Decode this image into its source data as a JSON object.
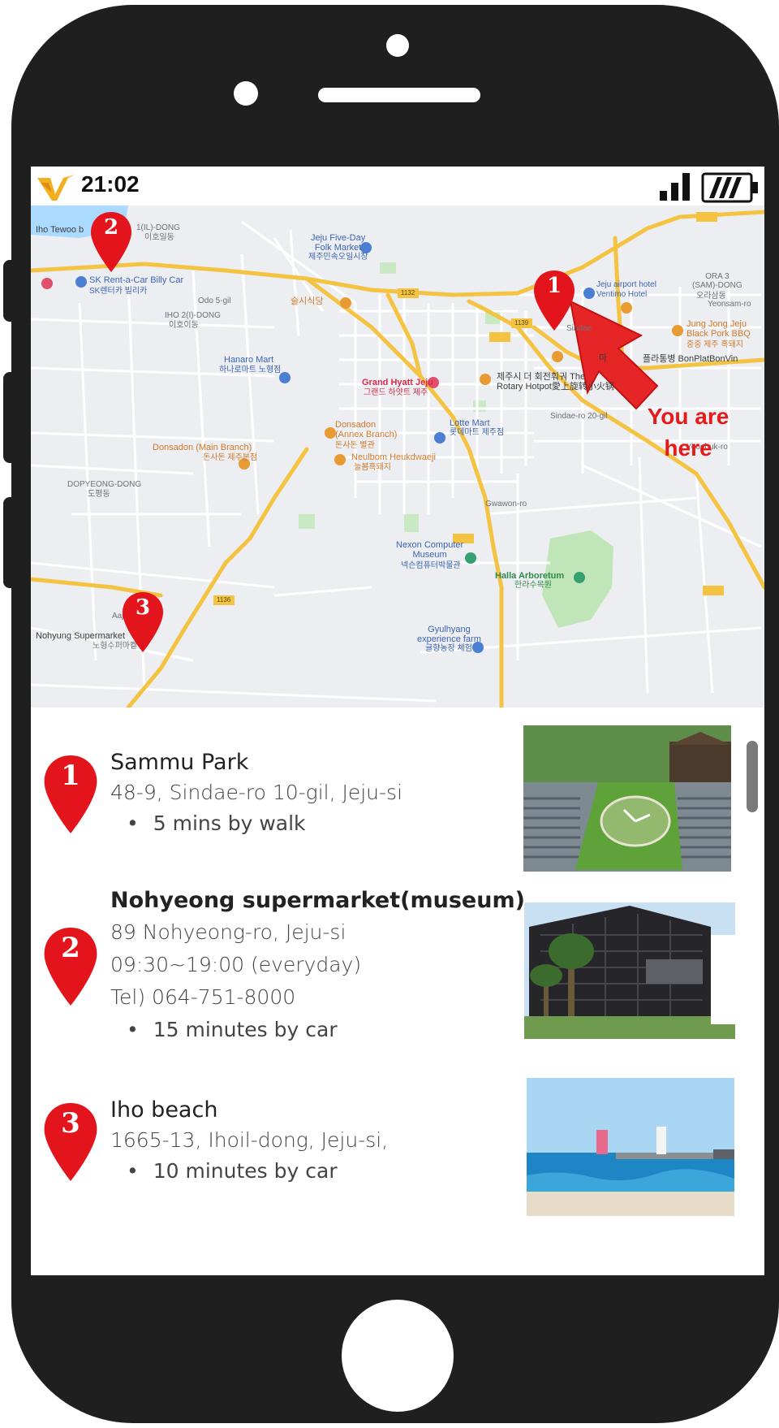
{
  "status_bar": {
    "time": "21:02",
    "logo": "brand-v-logo",
    "signal": "signal-bars-icon",
    "battery": "battery-icon"
  },
  "map": {
    "callout": {
      "line1": "You are",
      "line2": "here"
    },
    "pins": [
      {
        "number": "1"
      },
      {
        "number": "2"
      },
      {
        "number": "3"
      }
    ],
    "labels": {
      "iho_tewoo": "Iho Tewoo b",
      "il_dong": "1(IL)-DONG",
      "il_dong_kr": "이호일동",
      "folk_market": "Jeju Five-Day\nFolk Market",
      "folk_market_kr": "제주민속오일시장",
      "sk_rent": "SK Rent-a-Car Billy Car",
      "sk_rent_kr": "SK렌터카 빌리카",
      "iho2_dong": "IHO 2(I)-DONG",
      "iho2_kr": "이호이동",
      "odo": "Odo 5-gil",
      "sulsigdang": "술시식당",
      "airport_hotel": "Jeju airport hotel",
      "ventimo": "Ventimo Hotel",
      "ora3": "ORA 3\n(SAM)-DONG",
      "ora3_kr": "오라삼동",
      "jung_jong": "Jung Jong Jeju\nBlack Pork BBQ",
      "jung_jong_kr": "중중 제주 흑돼지",
      "bonplat": "플라통병 BonPlatBonVin",
      "hanaro": "Hanaro Mart",
      "hanaro_kr": "하나로마트 노형점",
      "grand_hyatt": "Grand Hyatt Jeju",
      "grand_hyatt_kr": "그랜드 하얏트 제주",
      "rotary": "제주시 더 회전훠궈 The\nRotary Hotpot愛上旋转小火锅",
      "lotte": "Lotte Mart",
      "lotte_kr": "롯데마트 제주점",
      "donsadon_main": "Donsadon (Main Branch)",
      "donsadon_main_kr": "돈사돈 제주본점",
      "donsadon_annex": "Donsadon\n(Annex Branch)",
      "donsadon_annex_kr": "돈사돈 별관",
      "neulbom": "Neulbom Heukdwaeji",
      "neulbom_kr": "늘봄흑돼지",
      "dopyeong": "DOPYEONG-DONG",
      "dopyeong_kr": "도평동",
      "nexon": "Nexon Computer\nMuseum",
      "nexon_kr": "넥슨컴퓨터박물관",
      "halla": "Halla Arboretum",
      "halla_kr": "한라수목원",
      "nohyung": "Nohyung Supermarket",
      "nohyung_kr": "노형수퍼마켙",
      "gyulhyang": "Gyulhyang\nexperience farm",
      "gyulhyang_kr": "귤향농장 체험",
      "yeonsam": "Yeonsam-ro",
      "yeonbuk": "Yeonbuk-ro",
      "sindae": "Sindae-ro 20-gil",
      "gwawon": "Gwawon-ro",
      "aajo": "Aajo-ro",
      "r1132": "1132",
      "r1139": "1139",
      "r1136": "1136",
      "sindae_short": "Sindae",
      "ma": "마"
    }
  },
  "places": [
    {
      "number": "1",
      "name": "Sammu Park",
      "lines": [
        "48-9, Sindae-ro 10-gil, Jeju-si"
      ],
      "travel": "5 mins by walk"
    },
    {
      "number": "2",
      "name": "Nohyeong supermarket(museum)",
      "lines": [
        "89 Nohyeong-ro, Jeju-si",
        "09:30~19:00 (everyday)",
        "Tel) 064-751-8000"
      ],
      "travel": "15 minutes by car"
    },
    {
      "number": "3",
      "name": "Iho beach",
      "lines": [
        "1665-13, Ihoil-dong, Jeju-si,"
      ],
      "travel": "10 minutes by car"
    }
  ],
  "colors": {
    "pin_red": "#e3141b",
    "frame": "#1f1f1f",
    "callout_red": "#e51b1b",
    "road_yellow": "#f5c342"
  }
}
